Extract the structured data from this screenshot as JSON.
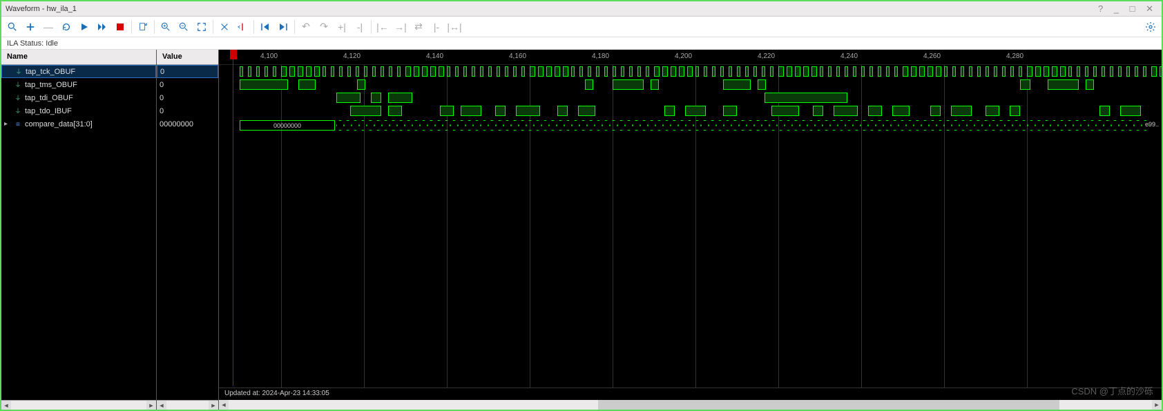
{
  "window": {
    "title": "Waveform - hw_ila_1"
  },
  "status": {
    "text": "ILA Status: Idle"
  },
  "toolbar": {
    "settings_icon": "gear"
  },
  "headers": {
    "name": "Name",
    "value": "Value"
  },
  "signals": [
    {
      "name": "tap_tck_OBUF",
      "value": "0",
      "type": "wire",
      "selected": true
    },
    {
      "name": "tap_tms_OBUF",
      "value": "0",
      "type": "wire",
      "selected": false
    },
    {
      "name": "tap_tdi_OBUF",
      "value": "0",
      "type": "wire",
      "selected": false
    },
    {
      "name": "tap_tdo_IBUF",
      "value": "0",
      "type": "wire",
      "selected": false
    },
    {
      "name": "compare_data[31:0]",
      "value": "00000000",
      "type": "bus",
      "selected": false
    }
  ],
  "ruler": {
    "ticks": [
      {
        "pos": 60,
        "label": "4,100"
      },
      {
        "pos": 180,
        "label": "4,120"
      },
      {
        "pos": 300,
        "label": "4,140"
      },
      {
        "pos": 420,
        "label": "4,160"
      },
      {
        "pos": 540,
        "label": "4,180"
      },
      {
        "pos": 660,
        "label": "4,200"
      },
      {
        "pos": 780,
        "label": "4,220"
      },
      {
        "pos": 900,
        "label": "4,240"
      },
      {
        "pos": 1020,
        "label": "4,260"
      },
      {
        "pos": 1140,
        "label": "4,280"
      }
    ]
  },
  "bus_initial": "00000000",
  "bus_final": "e99..",
  "footer": {
    "text": "Updated at: 2024-Apr-23 14:33:05"
  },
  "watermark": "CSDN @丁点的沙砾"
}
